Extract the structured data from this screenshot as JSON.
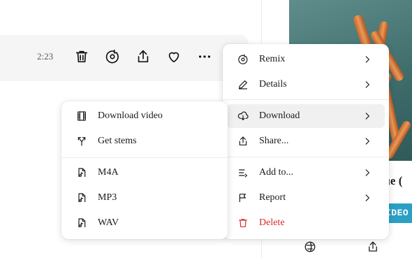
{
  "track": {
    "duration": "2:23"
  },
  "main_menu": {
    "items": [
      {
        "label": "Remix",
        "icon": "remix-icon",
        "submenu": true
      },
      {
        "label": "Details",
        "icon": "pencil-icon",
        "submenu": true
      },
      {
        "label": "Download",
        "icon": "cloud-download-icon",
        "submenu": true,
        "active": true
      },
      {
        "label": "Share...",
        "icon": "share-icon",
        "submenu": true
      },
      {
        "label": "Add to...",
        "icon": "add-to-list-icon",
        "submenu": true
      },
      {
        "label": "Report",
        "icon": "flag-icon",
        "submenu": true
      },
      {
        "label": "Delete",
        "icon": "trash-icon",
        "submenu": false
      }
    ]
  },
  "download_menu": {
    "items": [
      {
        "label": "Download video",
        "icon": "film-icon"
      },
      {
        "label": "Get stems",
        "icon": "stems-icon"
      },
      {
        "label": "M4A",
        "icon": "audio-file-icon"
      },
      {
        "label": "MP3",
        "icon": "audio-file-icon"
      },
      {
        "label": "WAV",
        "icon": "audio-file-icon"
      }
    ]
  },
  "side_panel": {
    "title_fragment": "que (",
    "badge": "IDEO"
  },
  "colors": {
    "danger": "#d92b2b",
    "badge": "#2aa0c4",
    "cover": "#4f7e7d"
  }
}
